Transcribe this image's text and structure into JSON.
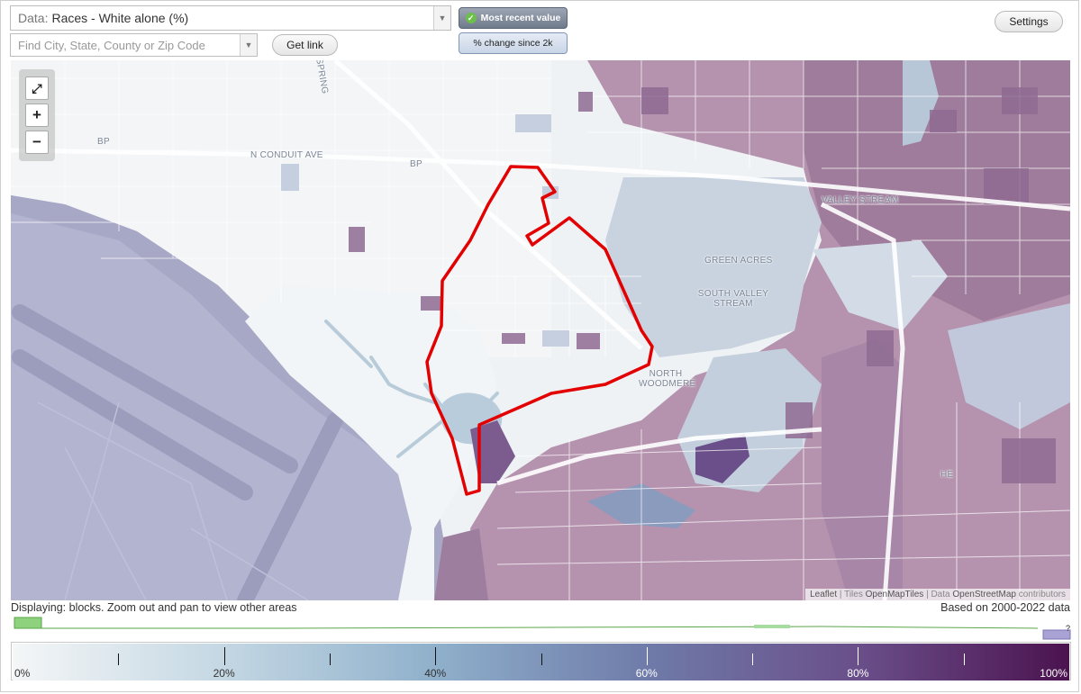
{
  "controls": {
    "data_prefix": "Data:",
    "data_value": "Races - White alone (%)",
    "search_placeholder": "Find City, State, County or Zip Code",
    "get_link": "Get link",
    "most_recent": "Most recent value",
    "pct_change": "% change since 2k",
    "settings": "Settings"
  },
  "map": {
    "labels": {
      "bp1": "BP",
      "bp2": "BP",
      "conduit": "N CONDUIT AVE",
      "valley_stream": "VALLEY STREAM",
      "green_acres": "GREEN ACRES",
      "south_valley_stream": "SOUTH VALLEY STREAM",
      "north_woodmere": "NORTH WOODMERE",
      "he": "HE",
      "springfield": "SPRING"
    },
    "attribution": {
      "leaflet": "Leaflet",
      "tiles_label": "Tiles",
      "tiles": "OpenMapTiles",
      "data_label": "Data",
      "data": "OpenStreetMap",
      "contrib": "contributors"
    },
    "zoom": {
      "fit": "⤢",
      "in": "+",
      "out": "−"
    }
  },
  "footer": {
    "displaying": "Displaying: blocks. Zoom out and pan to view other areas",
    "based_on": "Based on 2000-2022 data",
    "question": "?"
  },
  "legend": {
    "labels": [
      "0%",
      "20%",
      "40%",
      "60%",
      "80%",
      "100%"
    ],
    "min": 0,
    "max": 100,
    "colors": [
      "#f4f6f7",
      "#c4d7e3",
      "#8fb0cb",
      "#6f7ba9",
      "#6a4f8a",
      "#4b134f"
    ]
  },
  "colors": {
    "outline": "#e00000",
    "accent_green": "#6cc04a"
  }
}
